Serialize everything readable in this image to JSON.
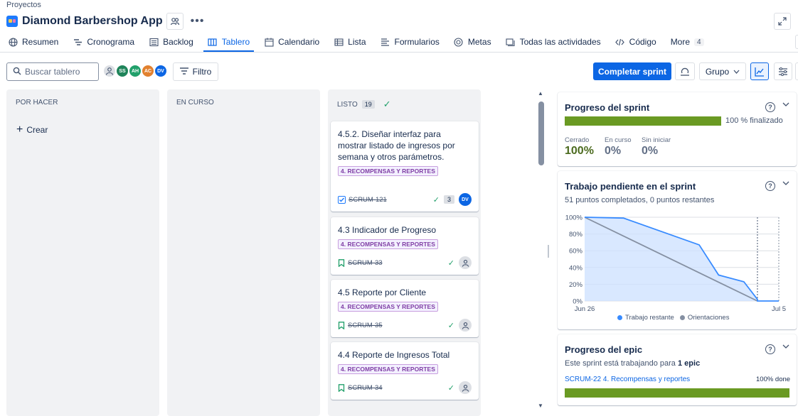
{
  "breadcrumb": "Proyectos",
  "app": {
    "title": "Diamond Barbershop App"
  },
  "tabs": [
    {
      "label": "Resumen",
      "icon": "globe-icon"
    },
    {
      "label": "Cronograma",
      "icon": "timeline-icon"
    },
    {
      "label": "Backlog",
      "icon": "backlog-icon"
    },
    {
      "label": "Tablero",
      "icon": "board-icon",
      "active": true
    },
    {
      "label": "Calendario",
      "icon": "calendar-icon"
    },
    {
      "label": "Lista",
      "icon": "list-icon"
    },
    {
      "label": "Formularios",
      "icon": "form-icon"
    },
    {
      "label": "Metas",
      "icon": "target-icon"
    },
    {
      "label": "Todas las actividades",
      "icon": "activity-icon"
    },
    {
      "label": "Código",
      "icon": "code-icon"
    },
    {
      "label": "More",
      "icon": "",
      "count": "4"
    }
  ],
  "toolbar": {
    "search_placeholder": "Buscar tablero",
    "filter_label": "Filtro",
    "complete_sprint_label": "Completar sprint",
    "group_label": "Grupo"
  },
  "avatars": [
    {
      "initials": "",
      "color": "#dcdfe4"
    },
    {
      "initials": "SS",
      "color": "#1f845a"
    },
    {
      "initials": "AH",
      "color": "#22a06b"
    },
    {
      "initials": "AC",
      "color": "#e2812f"
    },
    {
      "initials": "DV",
      "color": "#0c66e4"
    }
  ],
  "columns": {
    "todo": {
      "title": "POR HACER",
      "create_label": "Crear"
    },
    "in_progress": {
      "title": "EN CURSO"
    },
    "done": {
      "title": "LISTO",
      "count": "19"
    }
  },
  "cards": [
    {
      "title": "4.5.2. Diseñar interfaz para mostrar listado de ingresos por semana y otros parámetros.",
      "label": "4. RECOMPENSAS Y REPORTES",
      "key": "SCRUM-121",
      "type": "task",
      "estimate": "3",
      "assignee": "DV"
    },
    {
      "title": "4.3 Indicador de Progreso",
      "label": "4. RECOMPENSAS Y REPORTES",
      "key": "SCRUM-33",
      "type": "story",
      "estimate": "",
      "assignee": ""
    },
    {
      "title": "4.5 Reporte por Cliente",
      "label": "4. RECOMPENSAS Y REPORTES",
      "key": "SCRUM-35",
      "type": "story",
      "estimate": "",
      "assignee": ""
    },
    {
      "title": "4.4 Reporte de Ingresos Total",
      "label": "4. RECOMPENSAS Y REPORTES",
      "key": "SCRUM-34",
      "type": "story",
      "estimate": "",
      "assignee": ""
    }
  ],
  "sprint_progress": {
    "title": "Progreso del sprint",
    "percent_label": "100 % finalizado",
    "progress": 1.0,
    "stats": [
      {
        "label": "Cerrado",
        "value": "100%",
        "color": "#4c6b1f"
      },
      {
        "label": "En curso",
        "value": "0%",
        "color": "#626f86"
      },
      {
        "label": "Sin iniciar",
        "value": "0%",
        "color": "#626f86"
      }
    ]
  },
  "burndown": {
    "title": "Trabajo pendiente en el sprint",
    "subtitle": "51 puntos completados, 0 puntos restantes",
    "legend_remaining": "Trabajo restante",
    "legend_guideline": "Orientaciones"
  },
  "chart_data": {
    "type": "line",
    "title": "Trabajo pendiente en el sprint",
    "y_ticks": [
      "100%",
      "80%",
      "60%",
      "40%",
      "20%",
      "0%"
    ],
    "x_ticks": [
      "Jun 26",
      "Jul 5"
    ],
    "ylim": [
      0,
      100
    ],
    "x_range": [
      0,
      1
    ],
    "series": [
      {
        "name": "Trabajo restante",
        "color": "#388bff",
        "fill": "#cce0ff",
        "points": [
          [
            0.0,
            100
          ],
          [
            0.2,
            99
          ],
          [
            0.59,
            67
          ],
          [
            0.69,
            31
          ],
          [
            0.82,
            23
          ],
          [
            0.89,
            2
          ],
          [
            0.89,
            0
          ],
          [
            1.0,
            0
          ]
        ]
      },
      {
        "name": "Orientaciones",
        "color": "#8590a2",
        "points": [
          [
            0.0,
            100
          ],
          [
            0.89,
            0
          ]
        ]
      }
    ],
    "marker_x": 0.89
  },
  "epic_progress": {
    "title": "Progreso del epic",
    "desc_prefix": "Este sprint está trabajando para",
    "desc_bold": "1 epic",
    "epic_link": "SCRUM-22 4. Recompensas y reportes",
    "epic_percent": "100% done",
    "progress": 1.0
  }
}
